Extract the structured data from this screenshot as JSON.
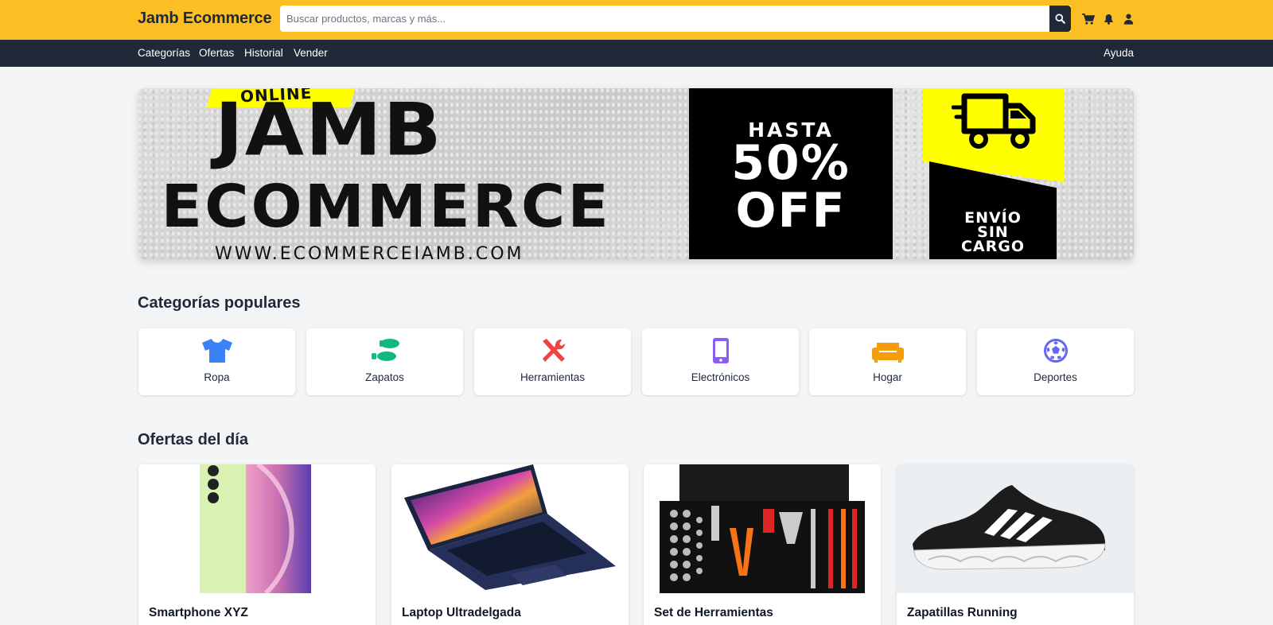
{
  "header": {
    "brand": "Jamb Ecommerce",
    "search_placeholder": "Buscar productos, marcas y más...",
    "icons": [
      "search-icon",
      "cart-icon",
      "bell-icon",
      "user-icon"
    ],
    "colors": {
      "topbar": "#fbbf24",
      "navbar": "#1f2937"
    }
  },
  "nav": {
    "links": [
      "Categorías",
      "Ofertas",
      "Historial",
      "Vender"
    ],
    "help": "Ayuda"
  },
  "banner": {
    "online": "ONLINE",
    "title_line1": "JAMB",
    "title_line2": "ECOMMERCE",
    "url": "WWW.ECOMMERCEJAMB.COM",
    "promo_hasta": "HASTA",
    "promo_pct": "50%",
    "promo_off": "OFF",
    "shipping_line1": "ENVÍO",
    "shipping_line2": "SIN",
    "shipping_line3": "CARGO"
  },
  "categories": {
    "title": "Categorías populares",
    "items": [
      {
        "label": "Ropa",
        "icon": "shirt-icon",
        "color": "#3b82f6"
      },
      {
        "label": "Zapatos",
        "icon": "shoe-prints-icon",
        "color": "#10b981"
      },
      {
        "label": "Herramientas",
        "icon": "tools-icon",
        "color": "#ef4444"
      },
      {
        "label": "Electrónicos",
        "icon": "mobile-icon",
        "color": "#8b5cf6"
      },
      {
        "label": "Hogar",
        "icon": "couch-icon",
        "color": "#f59e0b"
      },
      {
        "label": "Deportes",
        "icon": "futbol-icon",
        "color": "#6366f1"
      }
    ]
  },
  "deals": {
    "title": "Ofertas del día",
    "items": [
      {
        "title": "Smartphone XYZ"
      },
      {
        "title": "Laptop Ultradelgada"
      },
      {
        "title": "Set de Herramientas"
      },
      {
        "title": "Zapatillas Running"
      }
    ]
  }
}
